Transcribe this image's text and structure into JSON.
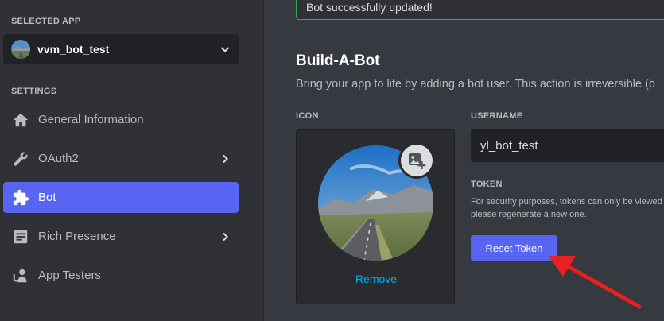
{
  "sidebar": {
    "selected_app_label": "SELECTED APP",
    "app_name": "vvm_bot_test",
    "settings_label": "SETTINGS",
    "items": [
      {
        "label": "General Information",
        "icon": "home-icon",
        "has_chevron": false,
        "active": false
      },
      {
        "label": "OAuth2",
        "icon": "wrench-icon",
        "has_chevron": true,
        "active": false
      },
      {
        "label": "Bot",
        "icon": "puzzle-icon",
        "has_chevron": false,
        "active": true
      },
      {
        "label": "Rich Presence",
        "icon": "document-icon",
        "has_chevron": true,
        "active": false
      },
      {
        "label": "App Testers",
        "icon": "person-icon",
        "has_chevron": false,
        "active": false
      }
    ]
  },
  "main": {
    "banner_text": "Bot successfully updated!",
    "title": "Build-A-Bot",
    "description": "Bring your app to life by adding a bot user. This action is irreversible (b",
    "icon_label": "ICON",
    "remove_label": "Remove",
    "username_label": "USERNAME",
    "username_value": "yl_bot_test",
    "token_label": "TOKEN",
    "token_hint_line1": "For security purposes, tokens can only be viewed",
    "token_hint_line2": "please regenerate a new one.",
    "reset_token_label": "Reset Token"
  },
  "colors": {
    "accent": "#5865f2",
    "success": "#3ba55d",
    "link": "#00aff4",
    "annotation_arrow": "#e8201f"
  }
}
